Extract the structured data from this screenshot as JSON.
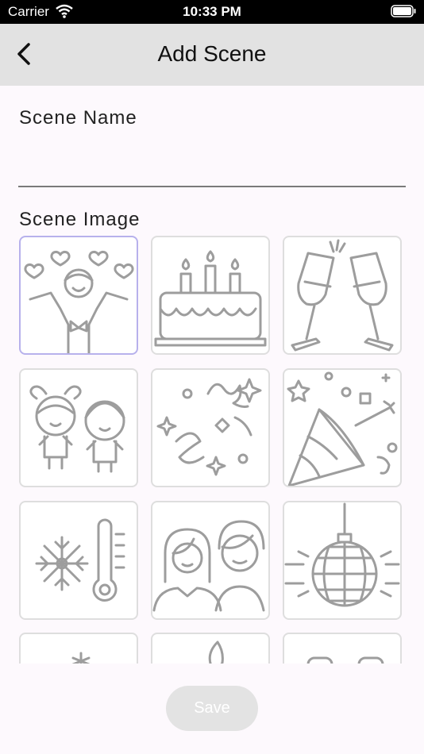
{
  "status_bar": {
    "carrier": "Carrier",
    "time": "10:33 PM"
  },
  "nav": {
    "title": "Add Scene",
    "back_icon": "chevron-left-icon"
  },
  "form": {
    "scene_name_label": "Scene Name",
    "scene_name_value": "",
    "scene_image_label": "Scene Image"
  },
  "images": [
    {
      "name": "celebration-hearts",
      "selected": true
    },
    {
      "name": "birthday-cake",
      "selected": false
    },
    {
      "name": "champagne-toast",
      "selected": false
    },
    {
      "name": "kids",
      "selected": false
    },
    {
      "name": "confetti",
      "selected": false
    },
    {
      "name": "party-popper",
      "selected": false
    },
    {
      "name": "winter-temperature",
      "selected": false
    },
    {
      "name": "couple",
      "selected": false
    },
    {
      "name": "disco-ball",
      "selected": false
    },
    {
      "name": "sparkle",
      "selected": false
    },
    {
      "name": "candle",
      "selected": false
    },
    {
      "name": "glasses",
      "selected": false
    }
  ],
  "save_button": {
    "label": "Save",
    "enabled": false
  },
  "colors": {
    "nav_background": "#e2e2e2",
    "selected_border": "#b7b1ec",
    "icon_stroke": "#9d9d9d"
  }
}
